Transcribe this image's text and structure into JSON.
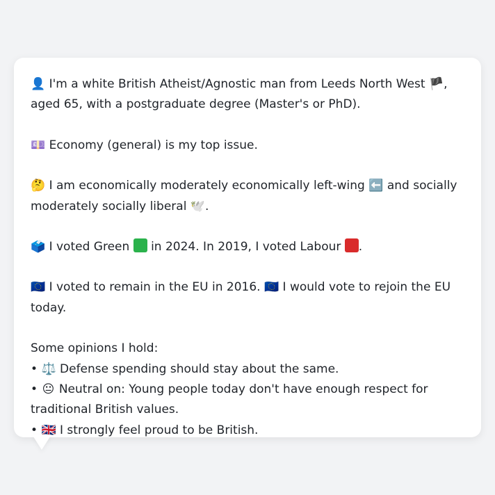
{
  "profile": {
    "intro": {
      "icon": "bust-in-silhouette-icon",
      "icon_glyph": "👤",
      "text_a": "I'm a white British Atheist/Agnostic man from Leeds North West",
      "flag_glyph": "🏴",
      "flag_icon": "england-flag-icon",
      "text_b": ", aged 65, with a postgraduate degree (Master's or PhD)."
    },
    "issue": {
      "icon": "money-icon",
      "icon_glyph": "💷",
      "text": "Economy (general) is my top issue."
    },
    "ideology": {
      "icon": "thinking-face-icon",
      "icon_glyph": "🤔",
      "text_a": "I am economically moderately economically left-wing",
      "left_icon": "left-arrow-icon",
      "left_glyph": "⬅️",
      "text_b": "and socially moderately socially liberal",
      "dove_icon": "dove-icon",
      "dove_glyph": "🕊️",
      "text_c": "."
    },
    "votes": {
      "icon": "ballot-box-icon",
      "icon_glyph": "🗳️",
      "text_a": "I voted Green",
      "green_color": "#2bb24c",
      "text_b": "in 2024. In 2019, I voted Labour",
      "red_color": "#d92b2b",
      "text_c": "."
    },
    "eu": {
      "icon": "eu-flag-icon",
      "icon_glyph": "🇪🇺",
      "text_a": "I voted to remain in the EU in 2016.",
      "icon2_glyph": "🇪🇺",
      "text_b": "I would vote to rejoin the EU today."
    },
    "opinions": {
      "title": "Some opinions I hold:",
      "items": [
        {
          "bullet": "•",
          "icon": "scales-icon",
          "glyph": "⚖️",
          "text": "Defense spending should stay about the same."
        },
        {
          "bullet": "•",
          "icon": "neutral-face-icon",
          "glyph": "😐",
          "text": "Neutral on: Young people today don't have enough respect for traditional British values."
        },
        {
          "bullet": "•",
          "icon": "uk-flag-icon",
          "glyph": "🇬🇧",
          "text": "I strongly feel proud to be British."
        }
      ]
    }
  }
}
